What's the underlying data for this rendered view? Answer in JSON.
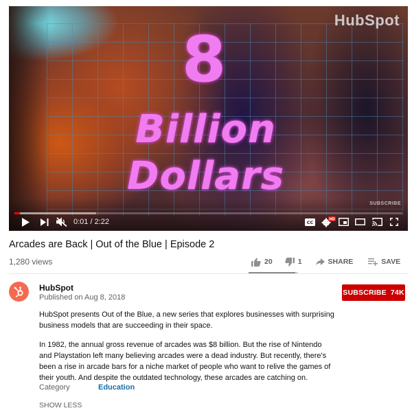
{
  "video": {
    "overlay": {
      "line1": "8",
      "line2": "Billion",
      "line3": "Dollars"
    },
    "watermark_brand": "HubSpot",
    "watermark_subscribe": "SUBSCRIBE",
    "progress": {
      "played_fraction": 0.007,
      "buffered_fraction": 0.21,
      "color": "#ff0000"
    },
    "time": {
      "current": "0:01",
      "separator": " / ",
      "duration": "2:22"
    },
    "controls": {
      "play_icon": "play-icon",
      "next_icon": "next-icon",
      "volume_icon": "volume-muted-icon",
      "captions_icon": "captions-icon",
      "settings_icon": "settings-gear-icon",
      "settings_badge": "HD",
      "miniplayer_icon": "miniplayer-icon",
      "theater_icon": "theater-mode-icon",
      "cast_icon": "cast-icon",
      "fullscreen_icon": "fullscreen-icon"
    }
  },
  "title": "Arcades are Back | Out of the Blue | Episode 2",
  "views": "1,280 views",
  "actions": {
    "likes": "20",
    "dislikes": "1",
    "share_label": "SHARE",
    "save_label": "SAVE",
    "more_label": "•••",
    "like_ratio": 0.95
  },
  "channel": {
    "name": "HubSpot",
    "published": "Published on Aug 8, 2018",
    "avatar_color": "#f26b51",
    "subscribe_label": "SUBSCRIBE",
    "subscriber_count": "74K",
    "subscribe_color": "#cc0000"
  },
  "description": {
    "paragraph1": "HubSpot presents Out of the Blue, a new series that explores businesses with surprising business models that are succeeding in their space.",
    "paragraph2": "In 1982, the annual gross revenue of arcades was $8 billion. But the rise of Nintendo and Playstation left many believing arcades were a dead industry. But recently, there's been a rise in arcade bars for a niche market of people who want to relive the games of their youth. And despite the outdated technology, these arcades are catching on.",
    "category_label": "Category",
    "category_value": "Education",
    "show_less_label": "SHOW LESS"
  }
}
